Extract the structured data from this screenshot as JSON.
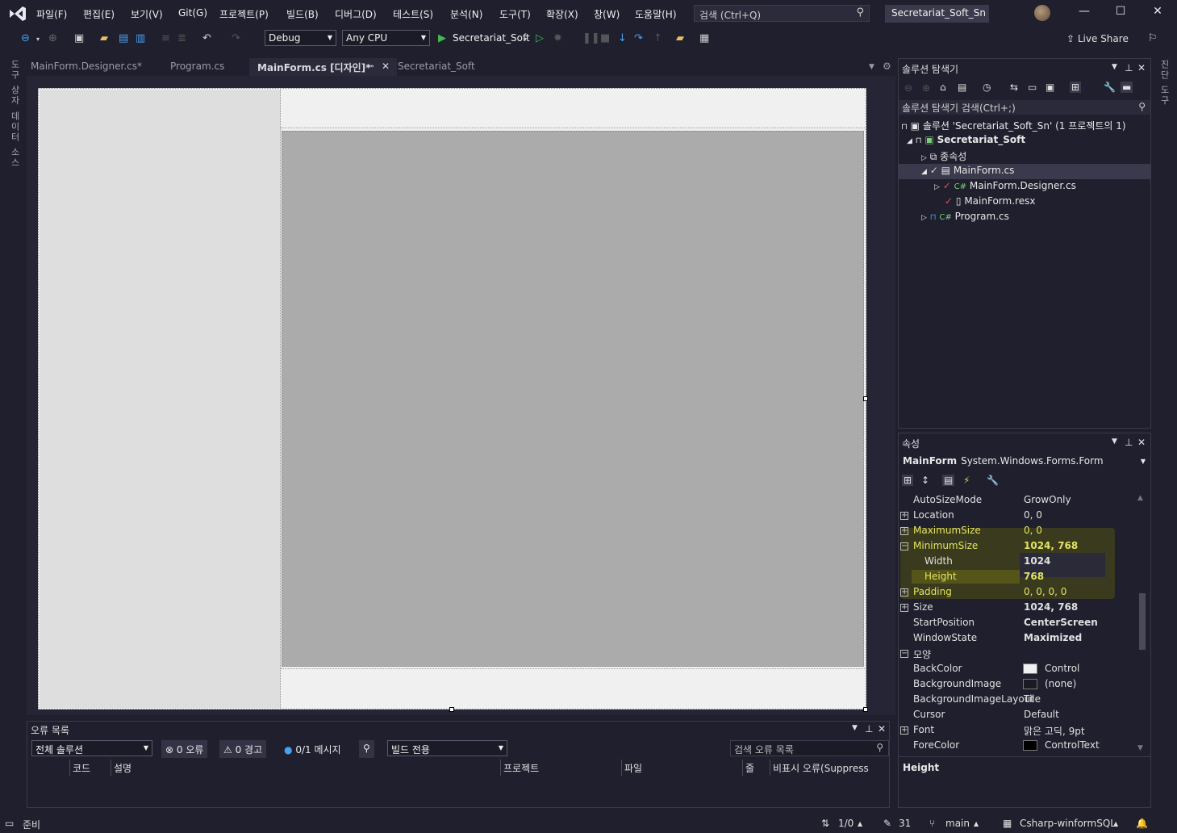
{
  "menu": {
    "items": [
      "파일(F)",
      "편집(E)",
      "보기(V)",
      "Git(G)",
      "프로젝트(P)",
      "빌드(B)",
      "디버그(D)",
      "테스트(S)",
      "분석(N)",
      "도구(T)",
      "확장(X)",
      "창(W)",
      "도움말(H)"
    ]
  },
  "search": {
    "placeholder": "검색 (Ctrl+Q)"
  },
  "solution_title": "Secretariat_Soft_Sn",
  "toolbar": {
    "config": "Debug",
    "platform": "Any CPU",
    "run_target": "Secretariat_Soft",
    "live_share": "Live Share"
  },
  "left_strip": {
    "toolbox": "도구 상자",
    "datasource": "데이터 소스"
  },
  "right_strip": {
    "label": "진단 도구"
  },
  "doc_tabs": [
    {
      "label": "MainForm.Designer.cs*"
    },
    {
      "label": "Program.cs"
    },
    {
      "label": "MainForm.cs [디자인]*"
    },
    {
      "label": "Secretariat_Soft"
    }
  ],
  "error_list": {
    "title": "오류 목록",
    "scope": "전체 솔루션",
    "errors": "0 오류",
    "warnings": "0 경고",
    "messages": "0/1 메시지",
    "build_filter": "빌드 전용",
    "search_placeholder": "검색 오류 목록",
    "columns": [
      "코드",
      "설명",
      "프로젝트",
      "파일",
      "줄",
      "비표시 오류(Suppress"
    ]
  },
  "solution_explorer": {
    "title": "솔루션 탐색기",
    "search_placeholder": "솔루션 탐색기 검색(Ctrl+;)",
    "tree": [
      {
        "label": "솔루션 'Secretariat_Soft_Sn' (1 프로젝트의 1)"
      },
      {
        "label": "Secretariat_Soft"
      },
      {
        "label": "종속성"
      },
      {
        "label": "MainForm.cs"
      },
      {
        "label": "MainForm.Designer.cs"
      },
      {
        "label": "MainForm.resx"
      },
      {
        "label": "Program.cs"
      }
    ]
  },
  "properties": {
    "title": "속성",
    "object_name": "MainForm",
    "object_type": "System.Windows.Forms.Form",
    "rows": [
      {
        "name": "AutoSizeMode",
        "value": "GrowOnly"
      },
      {
        "name": "Location",
        "value": "0, 0"
      },
      {
        "name": "MaximumSize",
        "value": "0, 0"
      },
      {
        "name": "MinimumSize",
        "value": "1024, 768"
      },
      {
        "name": "Width",
        "value": "1024"
      },
      {
        "name": "Height",
        "value": "768"
      },
      {
        "name": "Padding",
        "value": "0, 0, 0, 0"
      },
      {
        "name": "Size",
        "value": "1024, 768"
      },
      {
        "name": "StartPosition",
        "value": "CenterScreen"
      },
      {
        "name": "WindowState",
        "value": "Maximized"
      },
      {
        "name": "모양",
        "value": ""
      },
      {
        "name": "BackColor",
        "value": "Control"
      },
      {
        "name": "BackgroundImage",
        "value": "(none)"
      },
      {
        "name": "BackgroundImageLayout",
        "value": "Tile"
      },
      {
        "name": "Cursor",
        "value": "Default"
      },
      {
        "name": "Font",
        "value": "맑은 고딕, 9pt"
      },
      {
        "name": "ForeColor",
        "value": "ControlText"
      }
    ],
    "description_title": "Height"
  },
  "status": {
    "ready": "준비",
    "sync": "1/0",
    "edits": "31",
    "branch": "main",
    "repo": "Csharp-winformSQL"
  },
  "colors": {
    "background": "#1f1f2e",
    "highlight_yellow": "#e4e460",
    "run_green": "#3fb950",
    "accent_blue": "#4aa0f0"
  }
}
